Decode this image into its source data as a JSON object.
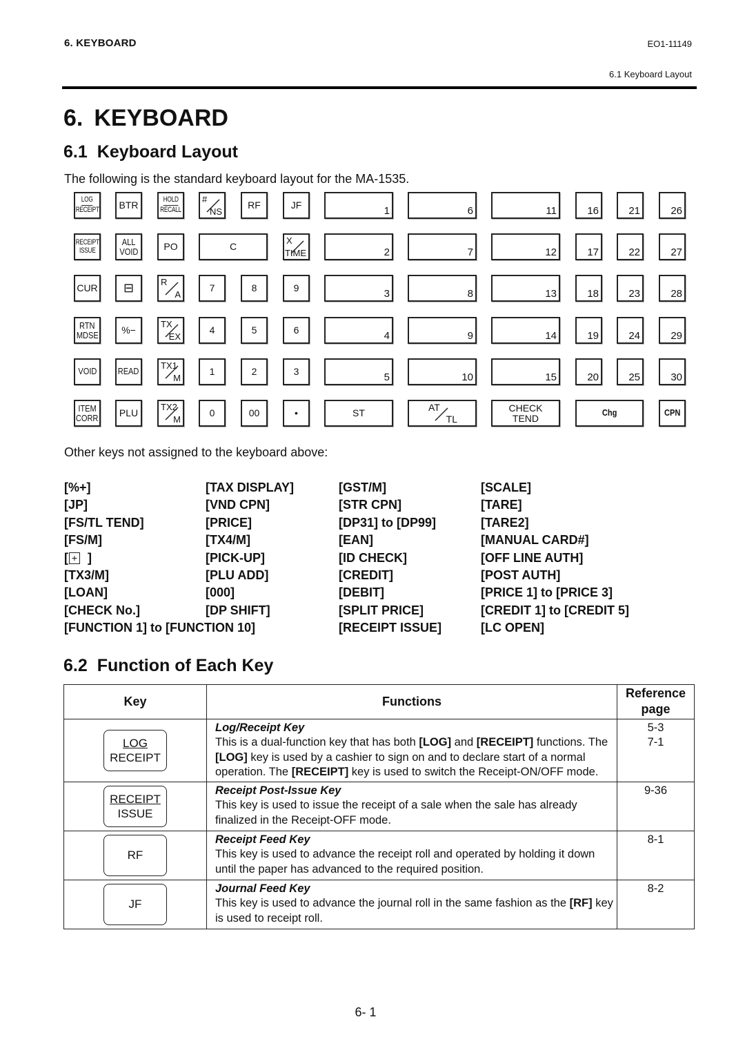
{
  "header": {
    "chapter": "6. KEYBOARD",
    "doc_id": "EO1-11149",
    "section_ref": "6.1 Keyboard Layout"
  },
  "title": {
    "num": "6.",
    "text": "KEYBOARD"
  },
  "section1": {
    "num": "6.1",
    "text": "Keyboard Layout",
    "intro": "The following is the standard keyboard layout for the MA-1535."
  },
  "keyboard": {
    "function_keys": [
      {
        "id": "log-receipt",
        "top": "LOG",
        "bottom": "RECEIPT",
        "style": "stacked-underline"
      },
      {
        "id": "btr",
        "label": "BTR"
      },
      {
        "id": "hold-recall",
        "top": "HOLD",
        "bottom": "RECALL",
        "style": "stacked-underline"
      },
      {
        "id": "ns",
        "top": "#",
        "bottom": "NS",
        "style": "fraction"
      },
      {
        "id": "rf",
        "label": "RF"
      },
      {
        "id": "jf",
        "label": "JF"
      },
      {
        "id": "receipt-issue",
        "top": "RECEIPT",
        "bottom": "ISSUE",
        "style": "stacked"
      },
      {
        "id": "all-void",
        "top": "ALL",
        "bottom": "VOID",
        "style": "stacked"
      },
      {
        "id": "po",
        "label": "PO"
      },
      {
        "id": "c",
        "label": "C"
      },
      {
        "id": "x-time",
        "top": "X",
        "bottom": "TIME",
        "style": "fraction"
      },
      {
        "id": "cur",
        "label": "CUR"
      },
      {
        "id": "minus-box",
        "label": "⊟"
      },
      {
        "id": "r-a",
        "top": "R",
        "bottom": "A",
        "style": "fraction"
      },
      {
        "id": "k7",
        "label": "7"
      },
      {
        "id": "k8",
        "label": "8"
      },
      {
        "id": "k9",
        "label": "9"
      },
      {
        "id": "rtn-mdse",
        "top": "RTN",
        "bottom": "MDSE",
        "style": "stacked"
      },
      {
        "id": "pct-minus",
        "label": "%−"
      },
      {
        "id": "tx-ex",
        "top": "TX",
        "bottom": "EX",
        "style": "fraction"
      },
      {
        "id": "k4",
        "label": "4"
      },
      {
        "id": "k5",
        "label": "5"
      },
      {
        "id": "k6",
        "label": "6"
      },
      {
        "id": "void",
        "label": "VOID"
      },
      {
        "id": "read",
        "label": "READ"
      },
      {
        "id": "tx1-m",
        "top": "TX1",
        "bottom": "M",
        "style": "fraction"
      },
      {
        "id": "k1",
        "label": "1"
      },
      {
        "id": "k2",
        "label": "2"
      },
      {
        "id": "k3",
        "label": "3"
      },
      {
        "id": "item-corr",
        "top": "ITEM",
        "bottom": "CORR",
        "style": "stacked"
      },
      {
        "id": "plu",
        "label": "PLU"
      },
      {
        "id": "tx2-m",
        "top": "TX2",
        "bottom": "M",
        "style": "fraction"
      },
      {
        "id": "k0",
        "label": "0"
      },
      {
        "id": "k00",
        "label": "00"
      },
      {
        "id": "dot",
        "label": "•"
      }
    ],
    "dept_keys": [
      "1",
      "2",
      "3",
      "4",
      "5",
      "6",
      "7",
      "8",
      "9",
      "10",
      "11",
      "12",
      "13",
      "14",
      "15",
      "16",
      "17",
      "18",
      "19",
      "20",
      "21",
      "22",
      "23",
      "24",
      "25",
      "26",
      "27",
      "28",
      "29",
      "30"
    ],
    "bottom_keys": {
      "st": "ST",
      "at": "AT",
      "tl": "TL",
      "check_top": "CHECK",
      "check_bottom": "TEND",
      "chg": "Chg",
      "cpn": "CPN"
    }
  },
  "other_keys": {
    "intro": "Other keys not assigned to the keyboard above:",
    "col1": [
      "[%+]",
      "[JP]",
      "[FS/TL TEND]",
      "[FS/M]",
      "[+]",
      "[TX3/M]",
      "[LOAN]",
      "[CHECK No.]",
      "[FUNCTION 1] to [FUNCTION 10]"
    ],
    "col2": [
      "[TAX DISPLAY]",
      "[VND CPN]",
      "[PRICE]",
      "[TX4/M]",
      "[PICK-UP]",
      "[PLU ADD]",
      "[000]",
      "[DP SHIFT]"
    ],
    "col3": [
      "[GST/M]",
      "[STR CPN]",
      "[DP31] to [DP99]",
      "[EAN]",
      "[ID CHECK]",
      "[CREDIT]",
      "[DEBIT]",
      "[SPLIT PRICE]",
      "[RECEIPT ISSUE]"
    ],
    "col4": [
      "[SCALE]",
      "[TARE]",
      "[TARE2]",
      "[MANUAL CARD#]",
      "[OFF LINE AUTH]",
      "[POST AUTH]",
      "[PRICE 1] to [PRICE 3]",
      "[CREDIT 1] to [CREDIT 5]",
      "[LC OPEN]"
    ]
  },
  "section2": {
    "num": "6.2",
    "text": "Function of Each Key"
  },
  "table": {
    "headers": {
      "key": "Key",
      "functions": "Functions",
      "ref1": "Reference",
      "ref2": "page"
    },
    "rows": [
      {
        "key_top": "LOG",
        "key_bottom": "RECEIPT",
        "title": "Log/Receipt Key",
        "desc_parts": [
          {
            "t": "This is a dual-function key that has both "
          },
          {
            "t": "[LOG]",
            "b": true
          },
          {
            "t": " and "
          },
          {
            "t": "[RECEIPT]",
            "b": true
          },
          {
            "t": " functions.  The "
          },
          {
            "t": "[LOG]",
            "b": true
          },
          {
            "t": " key is used by a cashier to sign on and to declare start of a normal operation.  The "
          },
          {
            "t": "[RECEIPT]",
            "b": true
          },
          {
            "t": " key is used to switch the Receipt-ON/OFF mode."
          }
        ],
        "refs": [
          "5-3",
          "7-1"
        ]
      },
      {
        "key_top": "RECEIPT",
        "key_bottom": "ISSUE",
        "title": "Receipt Post-Issue Key",
        "desc_parts": [
          {
            "t": "This key is used to issue the receipt of a sale when the sale has already finalized in the Receipt-OFF mode."
          }
        ],
        "refs": [
          "9-36"
        ]
      },
      {
        "key_top": "",
        "key_bottom": "RF",
        "title": "Receipt Feed Key",
        "desc_parts": [
          {
            "t": "This key is used to advance the receipt roll and operated by holding it down until the paper has advanced to the required position."
          }
        ],
        "refs": [
          "8-1"
        ]
      },
      {
        "key_top": "",
        "key_bottom": "JF",
        "title": "Journal Feed Key",
        "desc_parts": [
          {
            "t": "This key is used to advance the journal roll in the same fashion as the "
          },
          {
            "t": "[RF]",
            "b": true
          },
          {
            "t": " key is used to receipt roll."
          }
        ],
        "refs": [
          "8-2"
        ]
      }
    ]
  },
  "footer": {
    "page": "6- 1"
  }
}
